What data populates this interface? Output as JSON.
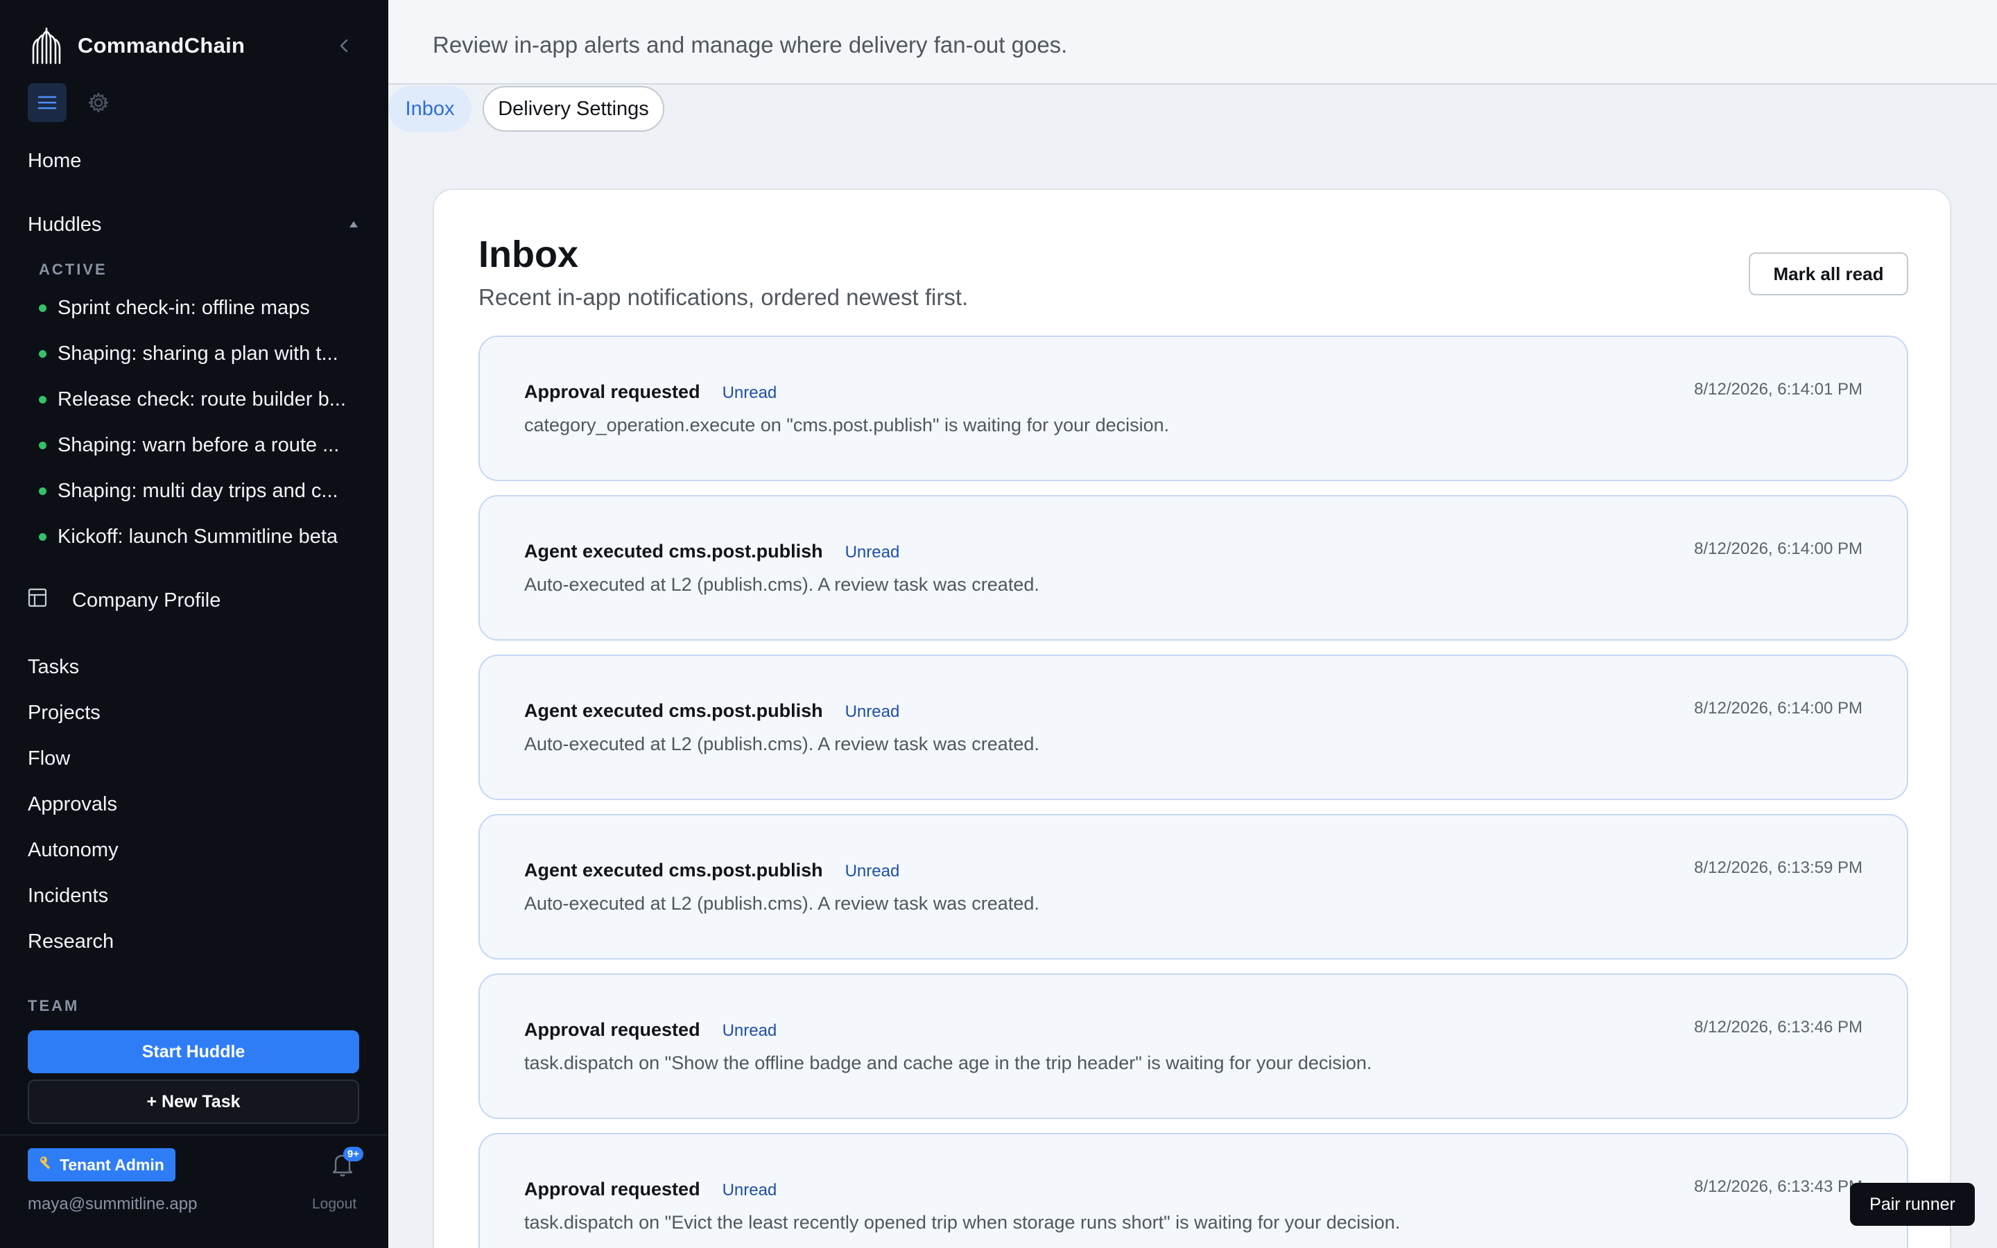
{
  "sidebar": {
    "brand_name": "CommandChain",
    "nav_home": "Home",
    "huddles_label": "Huddles",
    "active_label": "ACTIVE",
    "huddles": [
      "Sprint check-in: offline maps",
      "Shaping: sharing a plan with t...",
      "Release check: route builder b...",
      "Shaping: warn before a route ...",
      "Shaping: multi day trips and c...",
      "Kickoff: launch Summitline beta"
    ],
    "company_profile": "Company Profile",
    "nav": [
      "Tasks",
      "Projects",
      "Flow",
      "Approvals",
      "Autonomy",
      "Incidents",
      "Research"
    ],
    "team_label": "TEAM",
    "start_huddle": "Start Huddle",
    "new_task": "+ New Task",
    "role_badge": "Tenant Admin",
    "notification_count": "9+",
    "user_email": "maya@summitline.app",
    "logout": "Logout"
  },
  "topbar": {
    "description": "Review in-app alerts and manage where delivery fan-out goes."
  },
  "tabs": {
    "inbox": "Inbox",
    "delivery_settings": "Delivery Settings"
  },
  "inbox": {
    "title": "Inbox",
    "subtitle": "Recent in-app notifications, ordered newest first.",
    "mark_all_read": "Mark all read",
    "notifications": [
      {
        "title": "Approval requested",
        "status": "Unread",
        "time": "8/12/2026, 6:14:01 PM",
        "body": "category_operation.execute on \"cms.post.publish\" is waiting for your decision."
      },
      {
        "title": "Agent executed cms.post.publish",
        "status": "Unread",
        "time": "8/12/2026, 6:14:00 PM",
        "body": "Auto-executed at L2 (publish.cms). A review task was created."
      },
      {
        "title": "Agent executed cms.post.publish",
        "status": "Unread",
        "time": "8/12/2026, 6:14:00 PM",
        "body": "Auto-executed at L2 (publish.cms). A review task was created."
      },
      {
        "title": "Agent executed cms.post.publish",
        "status": "Unread",
        "time": "8/12/2026, 6:13:59 PM",
        "body": "Auto-executed at L2 (publish.cms). A review task was created."
      },
      {
        "title": "Approval requested",
        "status": "Unread",
        "time": "8/12/2026, 6:13:46 PM",
        "body": "task.dispatch on \"Show the offline badge and cache age in the trip header\" is waiting for your decision."
      },
      {
        "title": "Approval requested",
        "status": "Unread",
        "time": "8/12/2026, 6:13:43 PM",
        "body": "task.dispatch on \"Evict the least recently opened trip when storage runs short\" is waiting for your decision."
      }
    ]
  },
  "pair_runner": "Pair runner",
  "colors": {
    "sidebar_bg": "#0c0f16",
    "accent": "#2f7df6",
    "status_dot": "#33c26a",
    "unread_badge": "#1f4fa8",
    "card_bg": "#f4f7fc"
  },
  "icons": {
    "brand": "trident-logo-icon",
    "collapse": "chevron-left-icon",
    "menu": "hamburger-icon",
    "settings": "gear-icon",
    "collapse_huddles": "caret-up-icon",
    "company": "layout-icon",
    "role": "key-icon",
    "notifications": "bell-icon"
  }
}
